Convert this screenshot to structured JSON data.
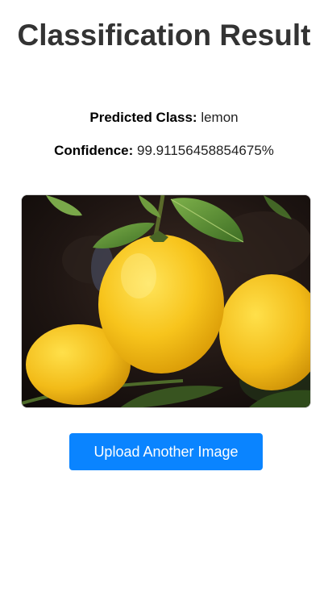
{
  "page": {
    "title": "Classification Result"
  },
  "result": {
    "predicted_label": "Predicted Class:",
    "predicted_value": "lemon",
    "confidence_label": "Confidence:",
    "confidence_value": "99.91156458854675%"
  },
  "image": {
    "subject": "lemons-on-branch"
  },
  "actions": {
    "upload_label": "Upload Another Image"
  },
  "colors": {
    "accent": "#0a84ff",
    "title": "#333333"
  }
}
